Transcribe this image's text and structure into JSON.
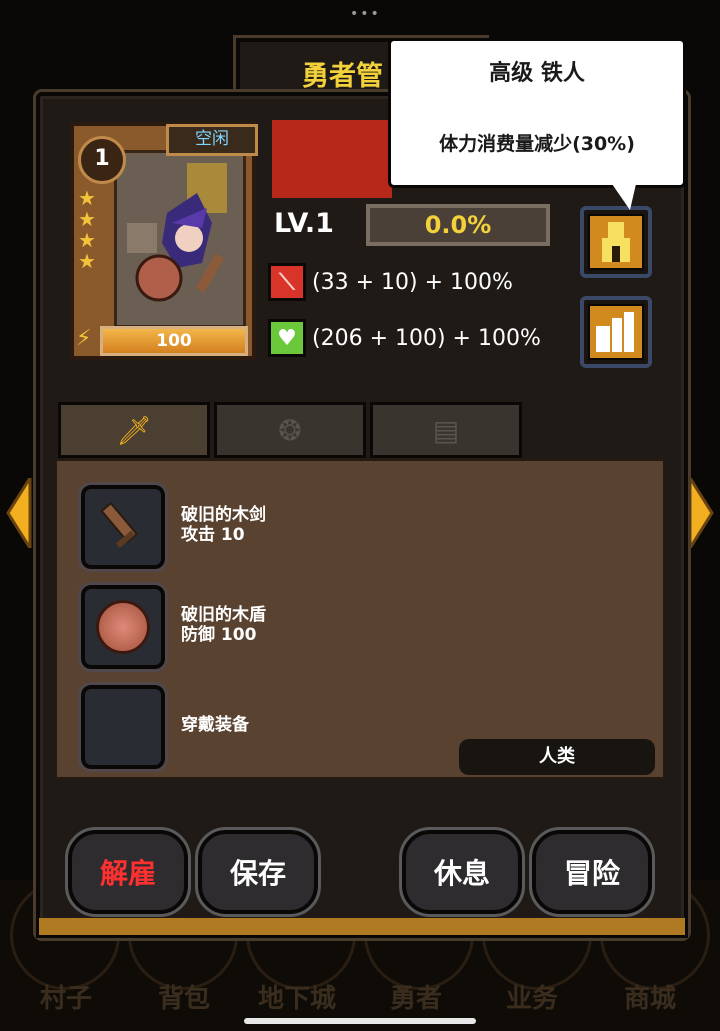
{
  "window": {
    "title": "勇者管"
  },
  "tooltip": {
    "title": "高级 铁人",
    "description": "体力消费量减少(30%)"
  },
  "hero": {
    "level_badge": "1",
    "status": "空闲",
    "stars": 4,
    "stamina": "100",
    "level": "LV.1",
    "xp_percent": "0.0%",
    "xp_fill": 0.0,
    "attack": "(33 + 10) + 100%",
    "defense": "(206 + 100) + 100%",
    "race": "人类"
  },
  "tabs": [
    {
      "icon": "sword-icon"
    },
    {
      "icon": "badge-icon"
    },
    {
      "icon": "scroll-icon"
    }
  ],
  "equipment": [
    {
      "name": "破旧的木剑",
      "stat": "攻击 10",
      "icon": "wooden-sword-icon"
    },
    {
      "name": "破旧的木盾",
      "stat": "防御 100",
      "icon": "wooden-shield-icon"
    },
    {
      "name": "穿戴装备",
      "stat": "",
      "icon": "empty-slot"
    }
  ],
  "actions": {
    "dismiss": "解雇",
    "save": "保存",
    "rest": "休息",
    "adventure": "冒险"
  },
  "bottom_nav": [
    "村子",
    "背包",
    "地下城",
    "勇者",
    "业务",
    "商城"
  ],
  "colors": {
    "panel_bg": "#1f1a16",
    "gold_text": "#f3d13b",
    "dismiss_red": "#ff3030",
    "equip_bg": "#5a4230",
    "status_blue": "#7fd5ff"
  }
}
